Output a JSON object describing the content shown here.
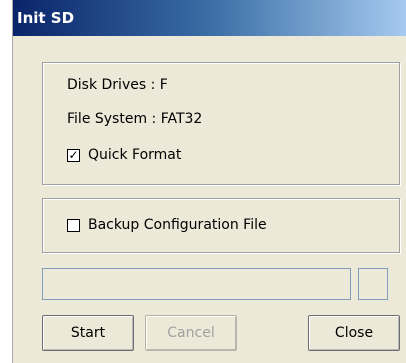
{
  "window": {
    "title": "Init SD"
  },
  "drive_info": {
    "disk_drives": "Disk Drives : F",
    "file_system": "File System : FAT32"
  },
  "quick_format": {
    "label": "Quick Format",
    "checked": true
  },
  "backup": {
    "label": "Backup Configuration File",
    "checked": false
  },
  "progress": {
    "value": 0
  },
  "buttons": {
    "start": "Start",
    "cancel": "Cancel",
    "close": "Close"
  }
}
